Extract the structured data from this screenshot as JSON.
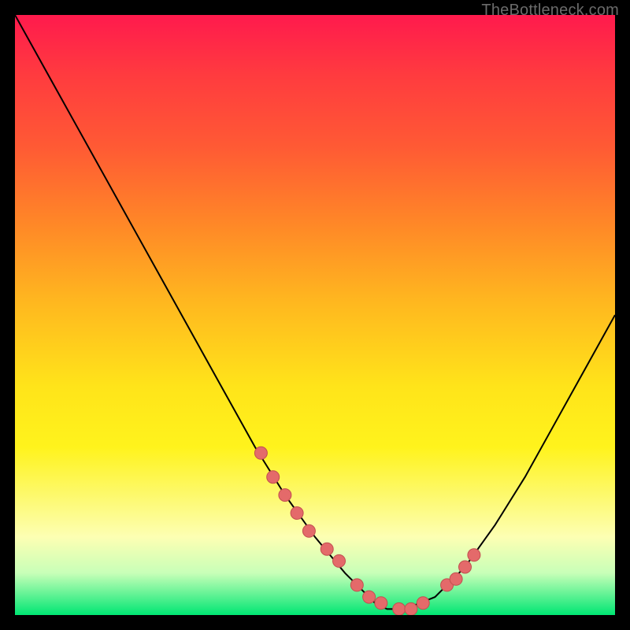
{
  "watermark": "TheBottleneck.com",
  "chart_data": {
    "type": "line",
    "title": "",
    "xlabel": "",
    "ylabel": "",
    "xlim": [
      0,
      100
    ],
    "ylim": [
      0,
      100
    ],
    "grid": false,
    "legend": false,
    "series": [
      {
        "name": "curve",
        "x": [
          0,
          5,
          10,
          15,
          20,
          25,
          30,
          35,
          40,
          45,
          50,
          55,
          58,
          60,
          62,
          65,
          70,
          75,
          80,
          85,
          90,
          95,
          100
        ],
        "values": [
          100,
          91,
          82,
          73,
          64,
          55,
          46,
          37,
          28,
          20,
          13,
          7,
          4,
          2,
          1,
          1,
          3,
          8,
          15,
          23,
          32,
          41,
          50
        ]
      }
    ],
    "markers": {
      "name": "dots",
      "x": [
        41,
        43,
        45,
        47,
        49,
        52,
        54,
        57,
        59,
        61,
        64,
        66,
        68,
        72,
        73.5,
        75,
        76.5
      ],
      "values": [
        27,
        23,
        20,
        17,
        14,
        11,
        9,
        5,
        3,
        2,
        1,
        1,
        2,
        5,
        6,
        8,
        10
      ]
    }
  },
  "styles": {
    "curve_stroke": "#000000",
    "curve_width": 2,
    "marker_fill": "#e46a6a",
    "marker_stroke": "#c24f4f",
    "marker_radius": 8
  }
}
